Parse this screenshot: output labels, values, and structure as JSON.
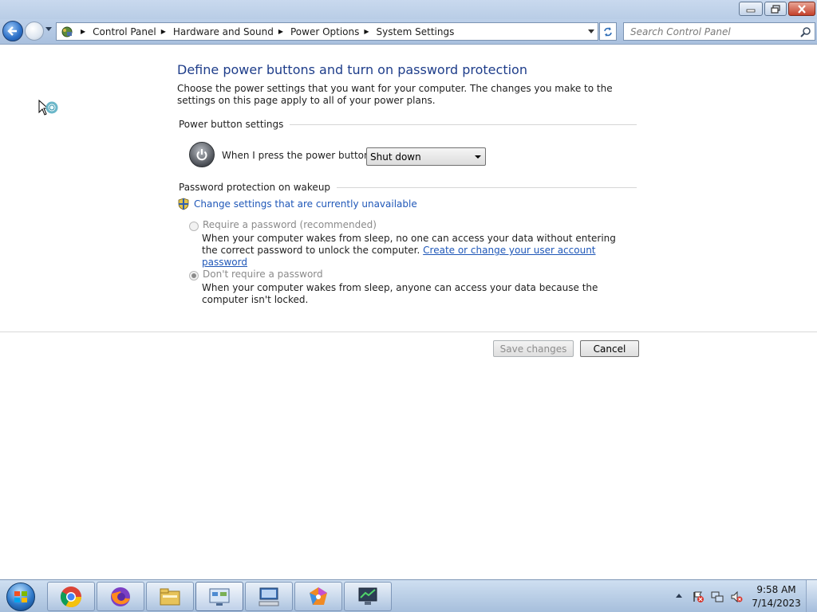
{
  "window": {
    "caption_buttons": [
      "minimize",
      "maximize",
      "close"
    ]
  },
  "nav": {
    "breadcrumbs": [
      "Control Panel",
      "Hardware and Sound",
      "Power Options",
      "System Settings"
    ],
    "search_placeholder": "Search Control Panel",
    "icons": [
      "back-icon",
      "forward-icon",
      "control-panel-icon",
      "refresh-icon",
      "search-icon"
    ]
  },
  "page": {
    "title": "Define power buttons and turn on password protection",
    "description": "Choose the power settings that you want for your computer. The changes you make to the settings on this page apply to all of your power plans.",
    "power_section_title": "Power button settings",
    "power_button_label": "When I press the power button:",
    "power_button_value": "Shut down",
    "password_section_title": "Password protection on wakeup",
    "change_settings_link": "Change settings that are currently unavailable",
    "option_require_label": "Require a password (recommended)",
    "option_require_desc": "When your computer wakes from sleep, no one can access your data without entering the correct password to unlock the computer.",
    "option_require_link": "Create or change your user account password",
    "option_norequire_label": "Don't require a password",
    "option_norequire_desc": "When your computer wakes from sleep, anyone can access your data because the computer isn't locked.",
    "selected_option": "dont_require",
    "save_label": "Save changes",
    "cancel_label": "Cancel"
  },
  "taskbar": {
    "pinned": [
      "chrome-icon",
      "firefox-icon",
      "file-explorer-icon",
      "control-panel-icon",
      "remote-desktop-icon",
      "paint-icon",
      "system-monitor-icon"
    ],
    "tray_icons": [
      "show-hidden-icons",
      "action-center-icon",
      "network-icon",
      "volume-icon"
    ],
    "clock_time": "9:58 AM",
    "clock_date": "7/14/2023"
  },
  "colors": {
    "title_text": "#1e3d8a",
    "link": "#1f57b8",
    "taskbar": "#b8cde6"
  }
}
